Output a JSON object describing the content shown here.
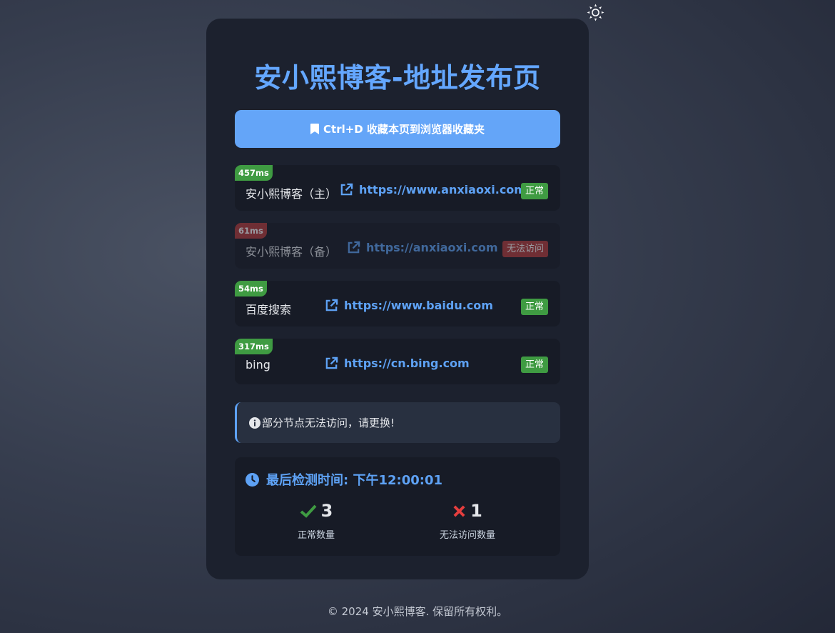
{
  "page": {
    "title": "安小熙博客-地址发布页",
    "footer": "© 2024 安小熙博客. 保留所有权利。"
  },
  "theme_toggle": {
    "icon": "sun-icon"
  },
  "bookmark": {
    "label": "Ctrl+D 收藏本页到浏览器收藏夹",
    "icon": "bookmark-icon"
  },
  "sites": [
    {
      "name": "安小熙博客（主）",
      "url": "https://www.anxiaoxi.com",
      "latency": "457ms",
      "status": "正常",
      "ok": true
    },
    {
      "name": "安小熙博客（备）",
      "url": "https://anxiaoxi.com",
      "latency": "61ms",
      "status": "无法访问",
      "ok": false
    },
    {
      "name": "百度搜索",
      "url": "https://www.baidu.com",
      "latency": "54ms",
      "status": "正常",
      "ok": true
    },
    {
      "name": "bing",
      "url": "https://cn.bing.com",
      "latency": "317ms",
      "status": "正常",
      "ok": true
    }
  ],
  "notice": {
    "icon": "info-icon",
    "text": "部分节点无法访问，请更换!"
  },
  "stats": {
    "check_time": "最后检测时间: 下午12:00:01",
    "ok_count": "3",
    "ok_label": "正常数量",
    "fail_count": "1",
    "fail_label": "无法访问数量"
  },
  "colors": {
    "accent": "#64a7ff",
    "ok": "#3f9b42",
    "bad": "#b33a3a",
    "card": "#1c212e"
  }
}
